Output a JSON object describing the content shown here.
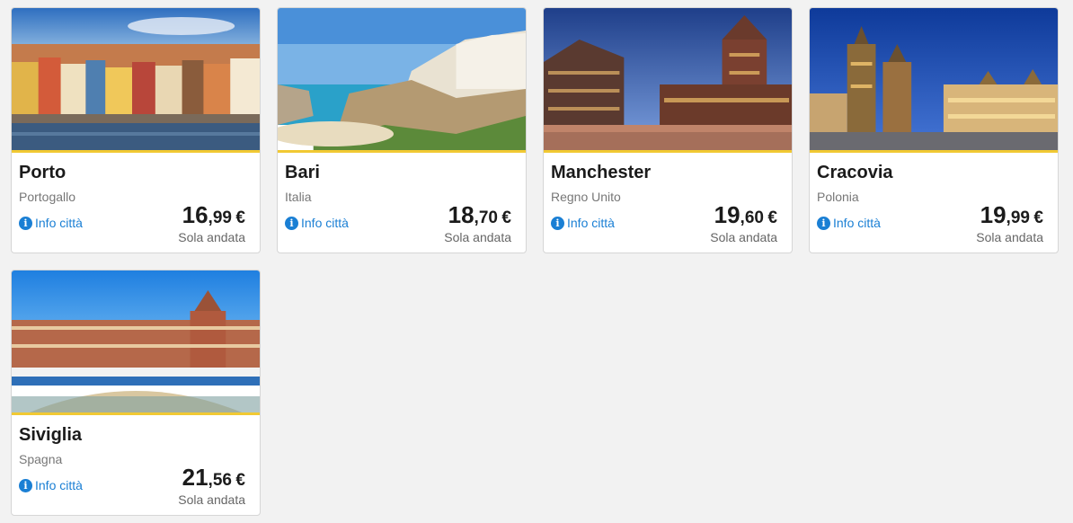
{
  "info_label": "Info città",
  "fare_label": "Sola andata",
  "currency": "€",
  "accent_color": "#f1c933",
  "link_color": "#1a7fd4",
  "destinations": [
    {
      "city": "Porto",
      "country": "Portogallo",
      "price_int": "16",
      "price_dec": ",99"
    },
    {
      "city": "Bari",
      "country": "Italia",
      "price_int": "18",
      "price_dec": ",70"
    },
    {
      "city": "Manchester",
      "country": "Regno Unito",
      "price_int": "19",
      "price_dec": ",60"
    },
    {
      "city": "Cracovia",
      "country": "Polonia",
      "price_int": "19",
      "price_dec": ",99"
    },
    {
      "city": "Siviglia",
      "country": "Spagna",
      "price_int": "21",
      "price_dec": ",56"
    }
  ]
}
